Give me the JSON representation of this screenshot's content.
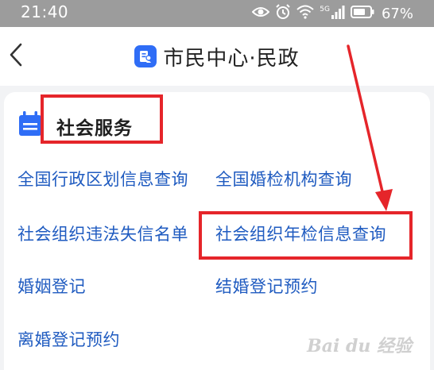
{
  "status_bar": {
    "time": "21:40",
    "battery": "67%",
    "network_label": "5G"
  },
  "header": {
    "title": "市民中心·民政"
  },
  "section": {
    "title": "社会服务",
    "items": [
      {
        "label": "全国行政区划信息查询"
      },
      {
        "label": "全国婚检机构查询"
      },
      {
        "label": "社会组织违法失信名单"
      },
      {
        "label": "社会组织年检信息查询"
      },
      {
        "label": "婚姻登记"
      },
      {
        "label": "结婚登记预约"
      },
      {
        "label": "离婚登记预约"
      }
    ]
  },
  "annotation": {
    "color": "#e5252a"
  },
  "watermark": "Bai du 经验",
  "colors": {
    "status_bar_bg": "#9c9c9c",
    "link_blue": "#1f5bc0",
    "brand_blue": "#2f6df6",
    "page_bg": "#f2f3f5"
  }
}
